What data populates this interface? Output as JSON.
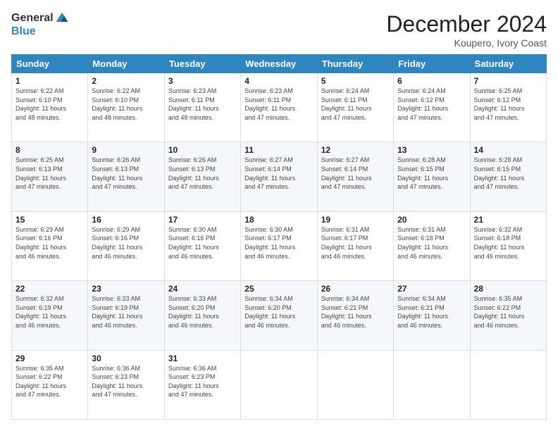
{
  "header": {
    "logo_general": "General",
    "logo_blue": "Blue",
    "month_title": "December 2024",
    "location": "Koupero, Ivory Coast"
  },
  "weekdays": [
    "Sunday",
    "Monday",
    "Tuesday",
    "Wednesday",
    "Thursday",
    "Friday",
    "Saturday"
  ],
  "weeks": [
    [
      {
        "day": "1",
        "info": "Sunrise: 6:22 AM\nSunset: 6:10 PM\nDaylight: 11 hours\nand 48 minutes."
      },
      {
        "day": "2",
        "info": "Sunrise: 6:22 AM\nSunset: 6:10 PM\nDaylight: 11 hours\nand 48 minutes."
      },
      {
        "day": "3",
        "info": "Sunrise: 6:23 AM\nSunset: 6:11 PM\nDaylight: 11 hours\nand 48 minutes."
      },
      {
        "day": "4",
        "info": "Sunrise: 6:23 AM\nSunset: 6:11 PM\nDaylight: 11 hours\nand 47 minutes."
      },
      {
        "day": "5",
        "info": "Sunrise: 6:24 AM\nSunset: 6:11 PM\nDaylight: 11 hours\nand 47 minutes."
      },
      {
        "day": "6",
        "info": "Sunrise: 6:24 AM\nSunset: 6:12 PM\nDaylight: 11 hours\nand 47 minutes."
      },
      {
        "day": "7",
        "info": "Sunrise: 6:25 AM\nSunset: 6:12 PM\nDaylight: 11 hours\nand 47 minutes."
      }
    ],
    [
      {
        "day": "8",
        "info": "Sunrise: 6:25 AM\nSunset: 6:13 PM\nDaylight: 11 hours\nand 47 minutes."
      },
      {
        "day": "9",
        "info": "Sunrise: 6:26 AM\nSunset: 6:13 PM\nDaylight: 11 hours\nand 47 minutes."
      },
      {
        "day": "10",
        "info": "Sunrise: 6:26 AM\nSunset: 6:13 PM\nDaylight: 11 hours\nand 47 minutes."
      },
      {
        "day": "11",
        "info": "Sunrise: 6:27 AM\nSunset: 6:14 PM\nDaylight: 11 hours\nand 47 minutes."
      },
      {
        "day": "12",
        "info": "Sunrise: 6:27 AM\nSunset: 6:14 PM\nDaylight: 11 hours\nand 47 minutes."
      },
      {
        "day": "13",
        "info": "Sunrise: 6:28 AM\nSunset: 6:15 PM\nDaylight: 11 hours\nand 47 minutes."
      },
      {
        "day": "14",
        "info": "Sunrise: 6:28 AM\nSunset: 6:15 PM\nDaylight: 11 hours\nand 47 minutes."
      }
    ],
    [
      {
        "day": "15",
        "info": "Sunrise: 6:29 AM\nSunset: 6:16 PM\nDaylight: 11 hours\nand 46 minutes."
      },
      {
        "day": "16",
        "info": "Sunrise: 6:29 AM\nSunset: 6:16 PM\nDaylight: 11 hours\nand 46 minutes."
      },
      {
        "day": "17",
        "info": "Sunrise: 6:30 AM\nSunset: 6:16 PM\nDaylight: 11 hours\nand 46 minutes."
      },
      {
        "day": "18",
        "info": "Sunrise: 6:30 AM\nSunset: 6:17 PM\nDaylight: 11 hours\nand 46 minutes."
      },
      {
        "day": "19",
        "info": "Sunrise: 6:31 AM\nSunset: 6:17 PM\nDaylight: 11 hours\nand 46 minutes."
      },
      {
        "day": "20",
        "info": "Sunrise: 6:31 AM\nSunset: 6:18 PM\nDaylight: 11 hours\nand 46 minutes."
      },
      {
        "day": "21",
        "info": "Sunrise: 6:32 AM\nSunset: 6:18 PM\nDaylight: 11 hours\nand 46 minutes."
      }
    ],
    [
      {
        "day": "22",
        "info": "Sunrise: 6:32 AM\nSunset: 6:19 PM\nDaylight: 11 hours\nand 46 minutes."
      },
      {
        "day": "23",
        "info": "Sunrise: 6:33 AM\nSunset: 6:19 PM\nDaylight: 11 hours\nand 46 minutes."
      },
      {
        "day": "24",
        "info": "Sunrise: 6:33 AM\nSunset: 6:20 PM\nDaylight: 11 hours\nand 46 minutes."
      },
      {
        "day": "25",
        "info": "Sunrise: 6:34 AM\nSunset: 6:20 PM\nDaylight: 11 hours\nand 46 minutes."
      },
      {
        "day": "26",
        "info": "Sunrise: 6:34 AM\nSunset: 6:21 PM\nDaylight: 11 hours\nand 46 minutes."
      },
      {
        "day": "27",
        "info": "Sunrise: 6:34 AM\nSunset: 6:21 PM\nDaylight: 11 hours\nand 46 minutes."
      },
      {
        "day": "28",
        "info": "Sunrise: 6:35 AM\nSunset: 6:22 PM\nDaylight: 11 hours\nand 46 minutes."
      }
    ],
    [
      {
        "day": "29",
        "info": "Sunrise: 6:35 AM\nSunset: 6:22 PM\nDaylight: 11 hours\nand 47 minutes."
      },
      {
        "day": "30",
        "info": "Sunrise: 6:36 AM\nSunset: 6:23 PM\nDaylight: 11 hours\nand 47 minutes."
      },
      {
        "day": "31",
        "info": "Sunrise: 6:36 AM\nSunset: 6:23 PM\nDaylight: 11 hours\nand 47 minutes."
      },
      null,
      null,
      null,
      null
    ]
  ]
}
